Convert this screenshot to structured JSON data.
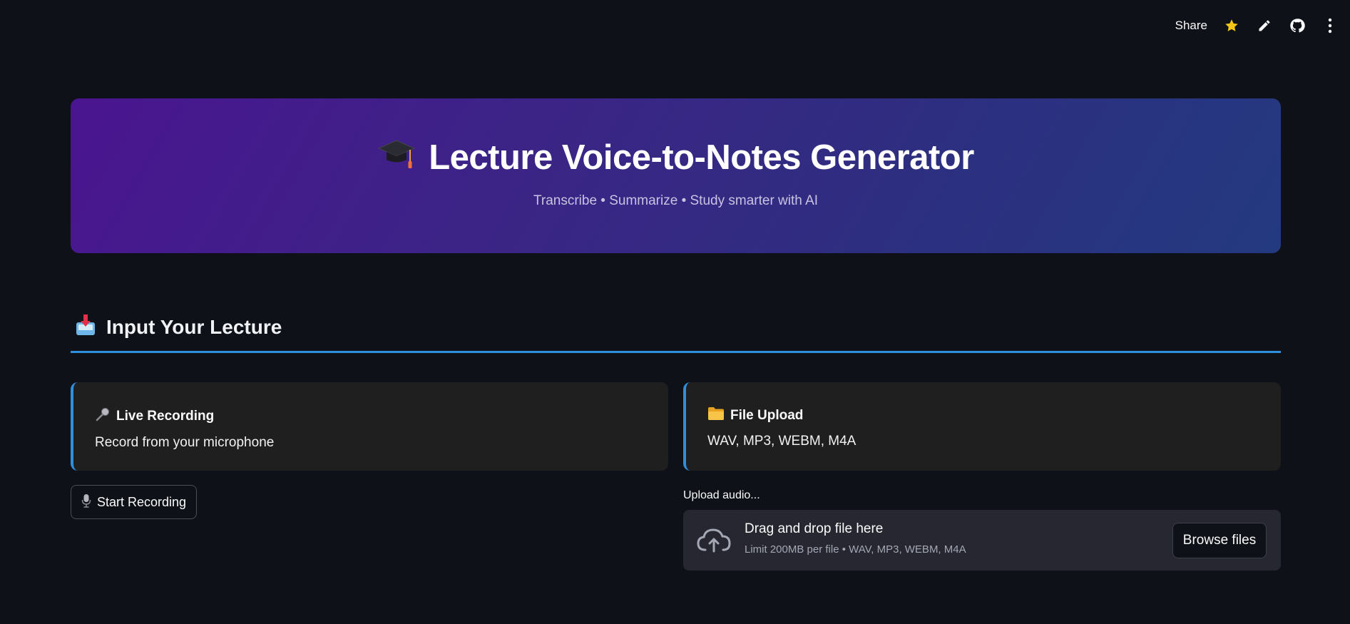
{
  "toolbar": {
    "share_label": "Share",
    "icons": [
      "star-icon",
      "pencil-icon",
      "github-icon",
      "kebab-menu-icon"
    ]
  },
  "hero": {
    "icon": "graduation-cap-icon",
    "title": "Lecture Voice-to-Notes Generator",
    "subtitle": "Transcribe • Summarize • Study smarter with AI"
  },
  "section": {
    "icon": "inbox-tray-icon",
    "title": "Input Your Lecture"
  },
  "cards": [
    {
      "icon": "microphone-icon",
      "title": "Live Recording",
      "description": "Record from your microphone"
    },
    {
      "icon": "folder-icon",
      "title": "File Upload",
      "description": "WAV, MP3, WEBM, M4A"
    }
  ],
  "record_button": {
    "icon": "studio-microphone-icon",
    "label": "Start Recording"
  },
  "uploader": {
    "label": "Upload audio...",
    "icon": "cloud-upload-icon",
    "drop_text": "Drag and drop file here",
    "limit_text": "Limit 200MB per file • WAV, MP3, WEBM, M4A",
    "browse_label": "Browse files"
  },
  "colors": {
    "background": "#0e1117",
    "accent": "#2f8fdc",
    "card": "#1f1f20",
    "dropzone": "#262730",
    "star": "#f5c518"
  }
}
